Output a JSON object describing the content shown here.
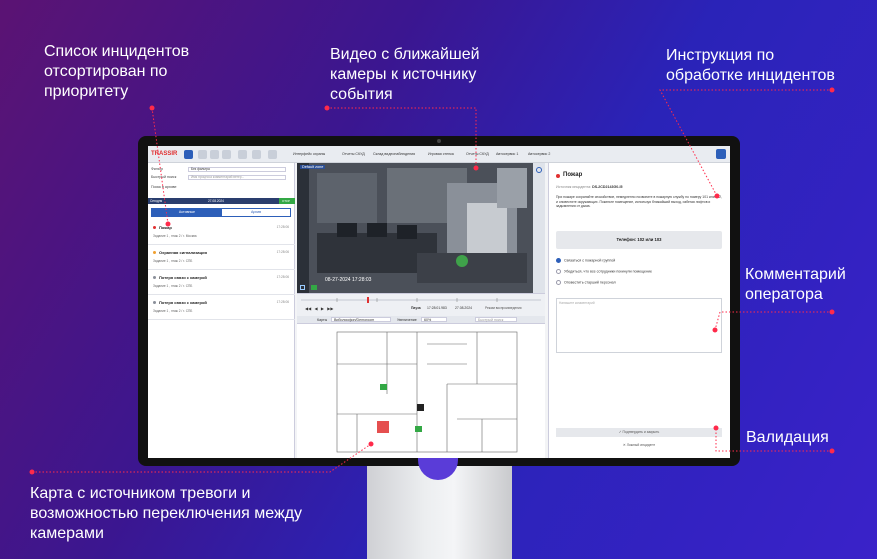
{
  "callouts": {
    "incidents_sorted": "Список инцидентов\nотсортирован по\nприоритету",
    "video_nearest": "Видео с ближайшей\nкамеры к источнику\nсобытия",
    "instructions": "Инструкция по\nобработке инцидентов",
    "operator_comment": "Комментарий\nоператора",
    "validation": "Валидация",
    "map_source": "Карта с источником тревоги и\nвозможностью переключения между\nкамерами"
  },
  "colors": {
    "accent": "#2d5fb9",
    "alert": "#e03030",
    "leader_dot": "#ff2a4a",
    "ok": "#33a845"
  },
  "app": {
    "logo_main": "TRASSIR",
    "tabs": [
      "Интерфейс охраны",
      "Отчеты СКУД",
      "Склад видеонаблюдения",
      "Игровая стенка",
      "Отчеты СКУД",
      "Автосервис 1",
      "Автосервис 2"
    ]
  },
  "left_panel": {
    "filter_label": "Фильтр",
    "filter_value": "Без фильтра",
    "quick_search_label": "Быстрый поиск",
    "quick_search_placeholder": "Имя процесса комментарий ветер...",
    "archive_search": "Поиск в архиве",
    "date_label": "Сегодня",
    "date_value": "27.08.2024",
    "date_badge": "ОТКР",
    "tab_active": "Активные",
    "tab_archive": "Архив",
    "incidents": [
      {
        "title": "Пожар",
        "sub": "Задание 1 , этаж 2 / г. Москва",
        "time": "17:28:06",
        "color": "#e03030"
      },
      {
        "title": "Охранная сигнализация",
        "sub": "Задание 1 , этаж 2 / г. СПБ",
        "time": "17:28:06",
        "color": "#f0a030"
      },
      {
        "title": "Потеря связи с камерой",
        "sub": "Задание 1 , этаж 2 / г. СПБ",
        "time": "17:28:06",
        "color": "#8a8f99"
      },
      {
        "title": "Потеря связи с камерой",
        "sub": "Задание 1 , этаж 2 / г. СПБ",
        "time": "17:28:06",
        "color": "#8a8f99"
      }
    ]
  },
  "video": {
    "label": "Default zone",
    "timestamp": "08-27-2024      17:28:03"
  },
  "timeline": {
    "pause_label": "Пауза",
    "time": "17:28:01.983",
    "date": "27.08.2024",
    "mode": "Режим воспроизведения"
  },
  "map_bar": {
    "maps_label": "Карты",
    "map_value": "Вибилиофон/Demoroom",
    "zoom_label": "Увеличение",
    "zoom_value": "60%",
    "search_placeholder": "Быстрый поиск"
  },
  "right_panel": {
    "title": "Пожар",
    "source_label": "Источник инцидента:",
    "source_value": "DS-2CD2143G0-I5",
    "instruction": "При пожаре сохраняйте спокойствие, немедленно позвоните в пожарную службу по номеру 101 или 112, и оповестите окружающих. Покиньте помещение, используя ближайший выход, избегая лифтов и задымления от дыма.",
    "phone": "Телефон: 102 или 103",
    "checklist": [
      {
        "label": "Связаться с пожарной группой",
        "checked": true
      },
      {
        "label": "Убедиться, что все сотрудники покинули помещение",
        "checked": false
      },
      {
        "label": "Оповестить старший персонал",
        "checked": false
      }
    ],
    "comment_placeholder": "Напишите комментарий",
    "confirm_button": "Подтвердить и закрыть",
    "false_button": "Ложный инцидент"
  }
}
